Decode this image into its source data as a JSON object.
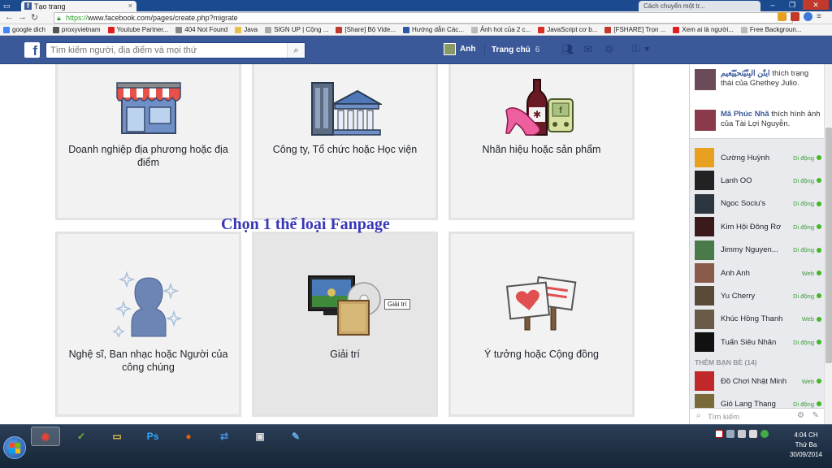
{
  "browser": {
    "tab_title": "Tạo trang",
    "other_tab_title": "Cách chuyển một tr...",
    "url_scheme": "https://",
    "url_rest": "www.facebook.com/pages/create.php?migrate",
    "bookmarks": [
      {
        "label": "google dich",
        "color": "#4285f4"
      },
      {
        "label": "proxyvietnam",
        "color": "#555555"
      },
      {
        "label": "Youtube Partner...",
        "color": "#e02020"
      },
      {
        "label": "404 Not Found",
        "color": "#888888"
      },
      {
        "label": "Java",
        "color": "#e8c04a"
      },
      {
        "label": "SIGN UP | Cộng ...",
        "color": "#aaaaaa"
      },
      {
        "label": "[Share] Bộ Vide...",
        "color": "#c0392b"
      },
      {
        "label": "Hướng dẫn Các...",
        "color": "#2a5aa8"
      },
      {
        "label": "Ảnh hot của 2 c...",
        "color": "#bbbbbb"
      },
      {
        "label": "JavaScript cơ b...",
        "color": "#d93025"
      },
      {
        "label": "[FSHARE] Trọn ...",
        "color": "#c0392b"
      },
      {
        "label": "Xem ai là người...",
        "color": "#e02020"
      },
      {
        "label": "Free Backgroun...",
        "color": "#bbbbbb"
      }
    ]
  },
  "fb_header": {
    "logo": "f",
    "search_placeholder": "Tìm kiếm người, địa điểm và mọi thứ",
    "user_name": "Anh",
    "home_label": "Trang chủ",
    "home_count": "6"
  },
  "categories": [
    {
      "label": "Doanh nghiệp địa phương hoặc địa điểm",
      "icon": "storefront-icon"
    },
    {
      "label": "Công ty, Tổ chức hoặc Học viện",
      "icon": "office-building-icon"
    },
    {
      "label": "Nhãn hiệu hoặc sản phẩm",
      "icon": "products-icon"
    },
    {
      "label": "Nghệ sĩ, Ban nhạc hoặc Người của công chúng",
      "icon": "public-figure-icon"
    },
    {
      "label": "Giải trí",
      "icon": "entertainment-icon",
      "tooltip": "Giải trí"
    },
    {
      "label": "Ý tưởng hoặc Cộng đồng",
      "icon": "signs-icon"
    }
  ],
  "overlay_title": "Chọn 1 thể loại Fanpage",
  "ticker": [
    {
      "name": "ايتّن البِنّيّتحيّيّعيم",
      "text": "thích trạng thái của Ghethey Julio.",
      "color": "#6b4a5a"
    },
    {
      "name": "Mã Phúc Nhã",
      "text": "thích hình ảnh của Tài Lợi Nguyễn.",
      "color": "#8a3a4a"
    }
  ],
  "chat": [
    {
      "name": "Cường Huỳnh",
      "status": "Di động",
      "color": "#e8a020"
    },
    {
      "name": "Lạnh OO",
      "status": "Di động",
      "color": "#222222"
    },
    {
      "name": "Ngoc Sociu's",
      "status": "Di động",
      "color": "#2b3640"
    },
    {
      "name": "Kim Hội Đông Rơ",
      "status": "Di động",
      "color": "#3a1a1a"
    },
    {
      "name": "Jimmy Nguyen...",
      "status": "Di động",
      "color": "#4a7a4a"
    },
    {
      "name": "Anh Anh",
      "status": "Web",
      "color": "#8a5a4a"
    },
    {
      "name": "Yu Cherry",
      "status": "Di động",
      "color": "#5a4a3a"
    },
    {
      "name": "Khúc Hồng Thanh",
      "status": "Web",
      "color": "#6a5a4a"
    },
    {
      "name": "Tuấn Siêu Nhân",
      "status": "Di động",
      "color": "#111111"
    }
  ],
  "suggest_header": "THÊM BẠN BÈ (14)",
  "suggest": [
    {
      "name": "Đồ Chơi Nhật Minh",
      "status": "Web",
      "color": "#c0282a"
    },
    {
      "name": "Gió Lang Thang",
      "status": "Di động",
      "color": "#7a6a3a"
    }
  ],
  "chat_search_placeholder": "Tìm kiếm",
  "taskbar": {
    "apps": [
      {
        "name": "chrome-app",
        "glyph": "◉",
        "color": "#e94235"
      },
      {
        "name": "utorrent-app",
        "glyph": "✓",
        "color": "#76b82a"
      },
      {
        "name": "explorer-app",
        "glyph": "▭",
        "color": "#e8c04a"
      },
      {
        "name": "photoshop-app",
        "glyph": "Ps",
        "color": "#31a8ff"
      },
      {
        "name": "firefox-app",
        "glyph": "●",
        "color": "#e66000"
      },
      {
        "name": "teamviewer-app",
        "glyph": "⇄",
        "color": "#4a90e2"
      },
      {
        "name": "screenshot-app",
        "glyph": "▣",
        "color": "#dddddd"
      },
      {
        "name": "paint-app",
        "glyph": "✎",
        "color": "#6ab0e8"
      }
    ],
    "time": "4:04 CH",
    "day": "Thứ Ba",
    "date": "30/09/2014"
  }
}
